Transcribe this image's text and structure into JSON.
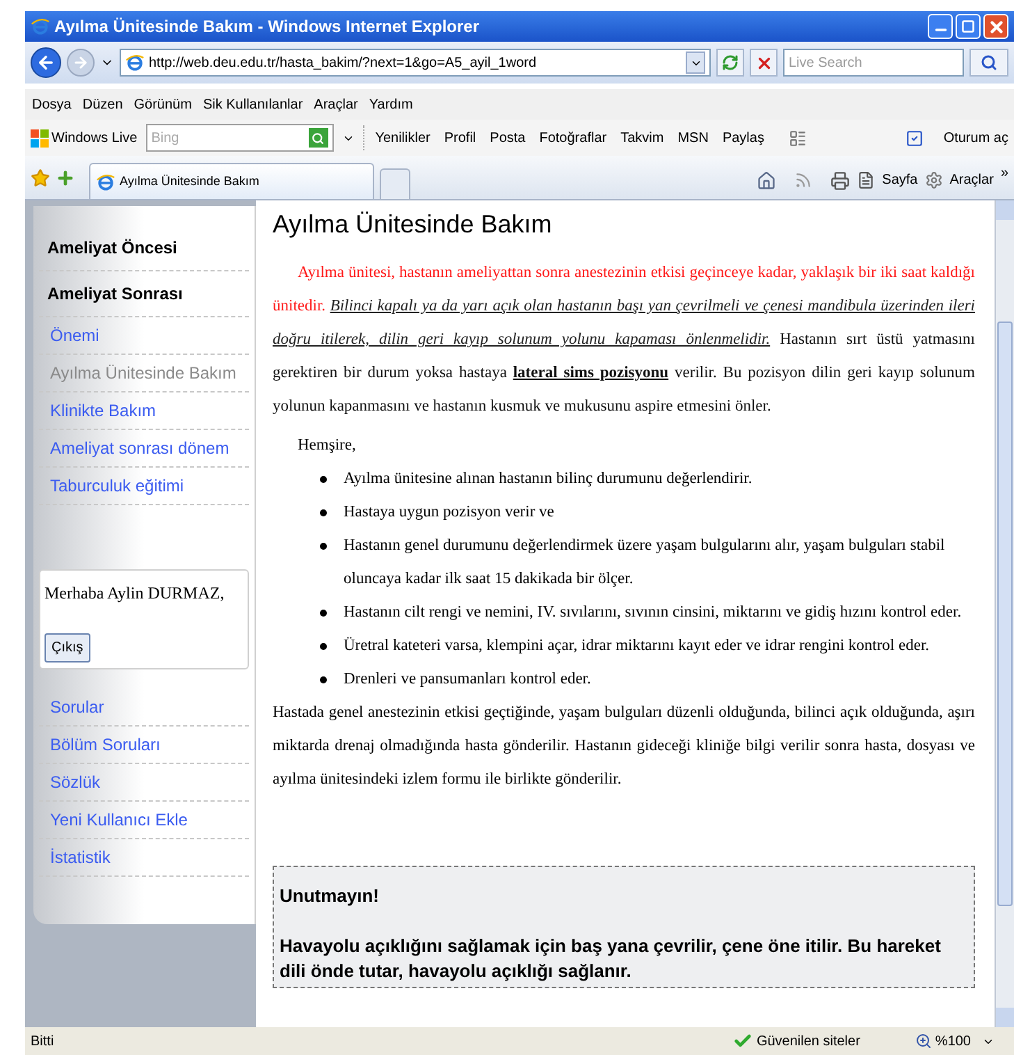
{
  "window": {
    "title": "Ayılma Ünitesinde Bakım - Windows Internet Explorer"
  },
  "address_bar": {
    "url": "http://web.deu.edu.tr/hasta_bakim/?next=1&go=A5_ayil_1word",
    "search_placeholder": "Live Search"
  },
  "menu": [
    "Dosya",
    "Düzen",
    "Görünüm",
    "Sik Kullanılanlar",
    "Araçlar",
    "Yardım"
  ],
  "links_bar": {
    "brand": "Windows Live",
    "search_placeholder": "Bing",
    "links": [
      "Yenilikler",
      "Profil",
      "Posta",
      "Fotoğraflar",
      "Takvim",
      "MSN",
      "Paylaş"
    ],
    "sign_in": "Oturum aç"
  },
  "tab": {
    "title": "Ayılma Ünitesinde Bakım"
  },
  "command_bar": {
    "page": "Sayfa",
    "tools": "Araçlar",
    "more": "»"
  },
  "sidebar": {
    "nav": [
      {
        "kind": "heading",
        "label": "Ameliyat Öncesi",
        "selected": false
      },
      {
        "kind": "heading",
        "label": "Ameliyat Sonrası",
        "selected": false
      },
      {
        "kind": "link",
        "label": "Önemi",
        "selected": false
      },
      {
        "kind": "link",
        "label": "Ayılma Ünitesinde Bakım",
        "selected": true
      },
      {
        "kind": "link",
        "label": "Klinikte Bakım",
        "selected": false
      },
      {
        "kind": "link",
        "label": "Ameliyat sonrası dönem",
        "selected": false
      },
      {
        "kind": "link",
        "label": "Taburculuk eğitimi",
        "selected": false
      }
    ],
    "user": {
      "greeting": "Merhaba Aylin DURMAZ,",
      "logout": "Çıkış"
    },
    "links": [
      "Sorular",
      "Bölüm Soruları",
      "Sözlük",
      "Yeni Kullanıcı Ekle",
      "İstatistik"
    ]
  },
  "article": {
    "title": "Ayılma Ünitesinde Bakım",
    "intro": [
      {
        "kind": "red",
        "text": "Ayılma ünitesi, hastanın ameliyattan sonra anestezinin etkisi geçinceye kadar, yaklaşık bir iki saat kaldığı ünitedir. "
      },
      {
        "kind": "italic-underline",
        "text": "Bilinci kapalı ya da yarı açık olan hastanın başı yan çevrilmeli ve çenesi mandibula üzerinden ileri doğru itilerek, dilin geri kayıp solunum yolunu kapaması önlenmelidir."
      },
      {
        "kind": "normal",
        "text": " Hastanın sırt üstü yatmasını gerektiren bir durum yoksa hastaya "
      },
      {
        "kind": "bold-underline",
        "text": "lateral sims pozisyonu"
      },
      {
        "kind": "normal",
        "text": " verilir. Bu pozisyon dilin geri kayıp solunum yolunun kapanmasını ve hastanın kusmuk ve mukusunu aspire etmesini önler."
      }
    ],
    "lead": "Hemşire,",
    "bullets": [
      "Ayılma ünitesine alınan hastanın bilinç durumunu değerlendirir.",
      "Hastaya uygun pozisyon verir ve",
      "Hastanın genel durumunu değerlendirmek üzere yaşam bulgularını alır, yaşam bulguları stabil oluncaya kadar ilk saat 15 dakikada bir ölçer.",
      "Hastanın cilt rengi ve nemini, IV. sıvılarını, sıvının cinsini, miktarını ve gidiş hızını kontrol eder.",
      "Üretral kateteri varsa, klempini açar, idrar miktarını kayıt eder ve idrar rengini kontrol eder.",
      "Drenleri ve pansumanları kontrol eder."
    ],
    "closing": "Hastada genel anestezinin etkisi geçtiğinde, yaşam bulguları düzenli olduğunda, bilinci açık olduğunda, aşırı miktarda drenaj olmadığında hasta gönderilir. Hastanın gideceği kliniğe bilgi verilir sonra hasta, dosyası ve ayılma ünitesindeki izlem formu ile birlikte gönderilir.",
    "note": {
      "title": "Unutmayın!",
      "text": "Havayolu açıklığını sağlamak için baş yana çevrilir, çene öne itilir. Bu hareket dili önde tutar, havayolu açıklığı sağlanır."
    }
  },
  "status_bar": {
    "text": "Bitti",
    "zone": "Güvenilen siteler",
    "zoom": "%100"
  }
}
